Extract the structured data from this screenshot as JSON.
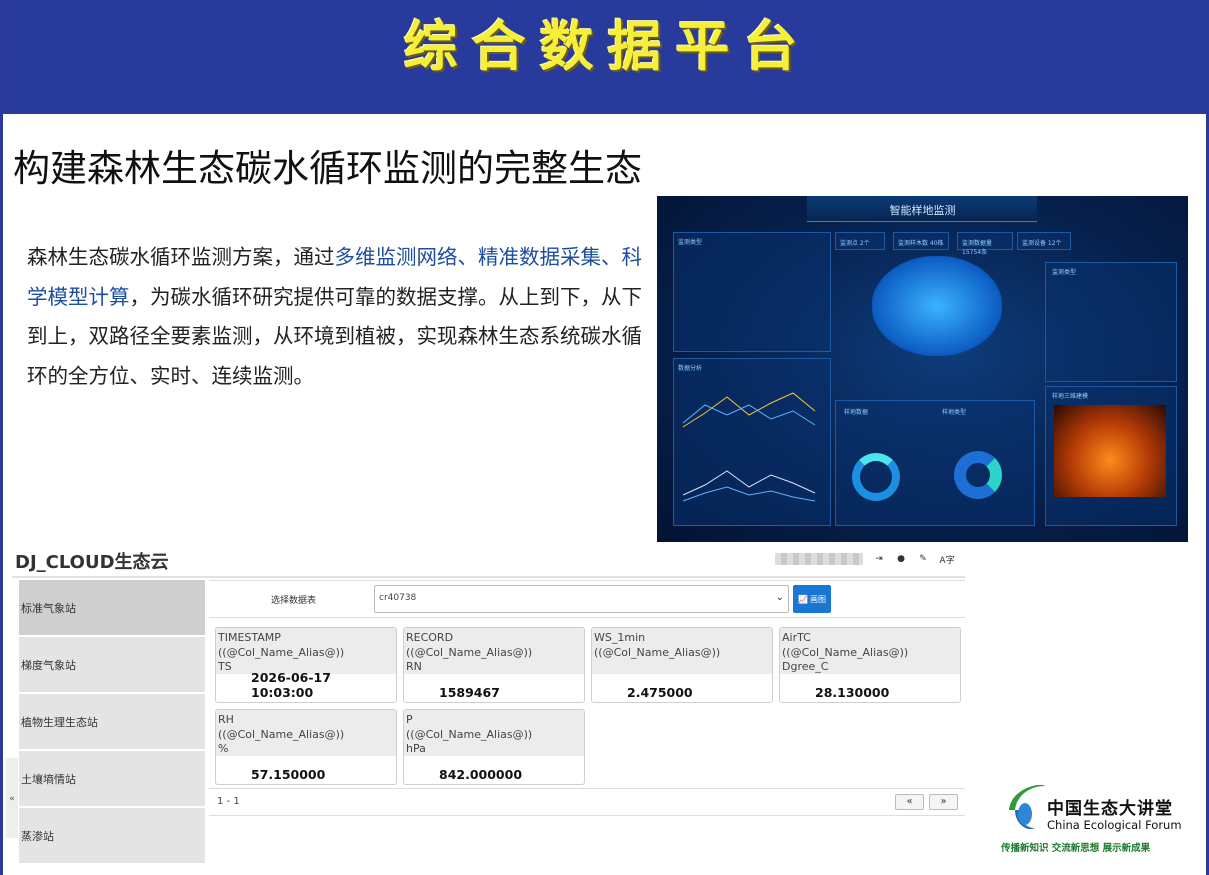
{
  "banner": {
    "title": "综合数据平台"
  },
  "headline": "构建森林生态碳水循环监测的完整生态",
  "paragraph": {
    "part1": "森林生态碳水循环监测方案，通过",
    "highlight": "多维监测网络、精准数据采集、科学模型计算",
    "part2": "，为碳水循环研究提供可靠的数据支撑。从上到下，从下到上，双路径全要素监测，从环境到植被，实现森林生态系统碳水循环的全方位、实时、连续监测。"
  },
  "dashboard_image": {
    "title": "智能样地监测",
    "stats": [
      "监测点 2个",
      "监测样木数 40株",
      "监测数据量 15754条",
      "监测设备 12个"
    ],
    "panels": [
      "监测类型",
      "数据分析",
      "样地数据",
      "样地类型",
      "监测类型",
      "样地三维建模"
    ]
  },
  "app": {
    "brand": "DJ_CLOUD生态云",
    "top_icons": [
      "logout-icon",
      "bell-icon",
      "pen-icon",
      "language-icon"
    ]
  },
  "sidebar": {
    "items": [
      {
        "label": "标准气象站"
      },
      {
        "label": "梯度气象站"
      },
      {
        "label": "植物生理生态站"
      },
      {
        "label": "土壤墒情站"
      },
      {
        "label": "蒸渗站"
      }
    ]
  },
  "selector": {
    "label": "选择数据表",
    "value": "cr40738",
    "button_label": "画图"
  },
  "cards": [
    {
      "name": "TIMESTAMP",
      "alias": "((@Col_Name_Alias@))",
      "unit": "TS",
      "value": "2026-06-17 10:03:00"
    },
    {
      "name": "RECORD",
      "alias": "((@Col_Name_Alias@))",
      "unit": "RN",
      "value": "1589467"
    },
    {
      "name": "WS_1min",
      "alias": "((@Col_Name_Alias@))",
      "unit": "",
      "value": "2.475000"
    },
    {
      "name": "AirTC",
      "alias": "((@Col_Name_Alias@))",
      "unit": "Dgree_C",
      "value": "28.130000"
    },
    {
      "name": "RH",
      "alias": "((@Col_Name_Alias@))",
      "unit": "%",
      "value": "57.150000"
    },
    {
      "name": "P",
      "alias": "((@Col_Name_Alias@))",
      "unit": "hPa",
      "value": "842.000000"
    }
  ],
  "pager": {
    "text": "1 - 1",
    "prev": "«",
    "next": "»"
  },
  "logo": {
    "cn": "中国生态大讲堂",
    "en": "China Ecological Forum",
    "slogan": "传播新知识   交流新思想   展示新成果"
  },
  "colors": {
    "banner": "#283a9c",
    "banner_text": "#f5ee3a",
    "accent_blue": "#1976d2",
    "highlight_text": "#1e4ea0"
  }
}
